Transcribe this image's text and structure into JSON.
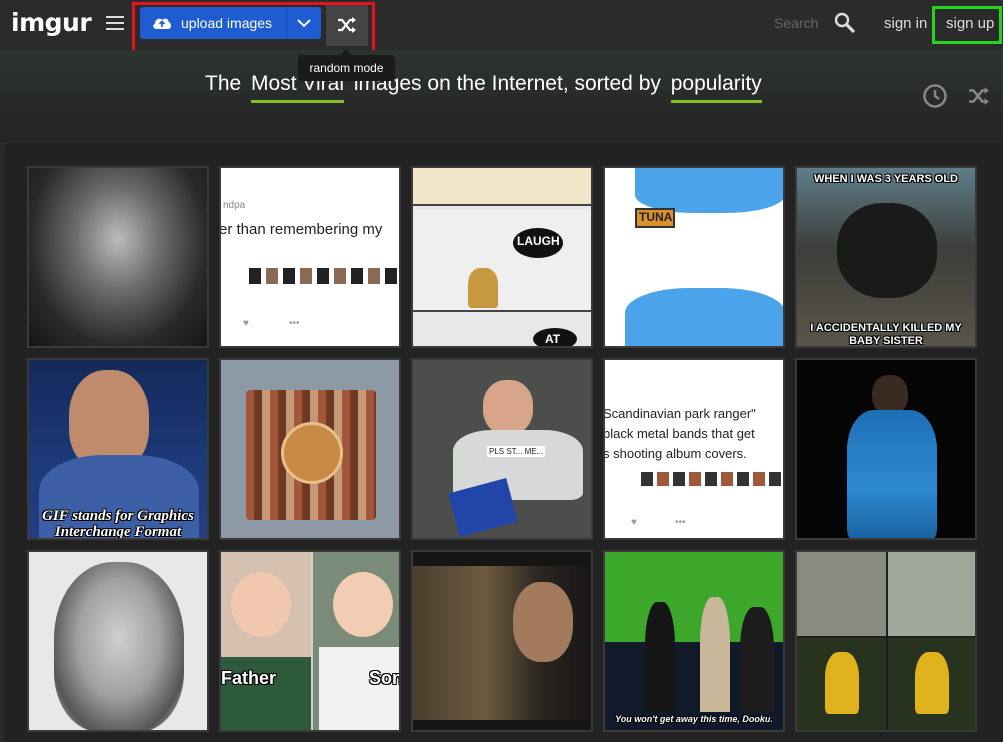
{
  "header": {
    "logo": "imgur",
    "upload_label": "upload images",
    "tooltip": "random mode",
    "search_placeholder": "Search",
    "signin": "sign in",
    "signup": "sign up"
  },
  "banner": {
    "prefix": "The",
    "section": "Most Viral",
    "middle": "images on the Internet, sorted by",
    "sort": "popularity"
  },
  "icons": {
    "menu": "hamburger-icon",
    "upload": "cloud-upload-icon",
    "caret": "chevron-down-icon",
    "random": "shuffle-icon",
    "search": "search-icon",
    "clock": "clock-icon"
  },
  "colors": {
    "upload_button": "#1f5bd1",
    "accent_underline": "#85bf25",
    "highlight_red": "#e5141b",
    "highlight_green": "#26d31f"
  },
  "gallery": {
    "row1": {
      "post_text": "er than remembering my",
      "post_handle": "ndpa",
      "comic_word": "LAUGH",
      "comic_word2": "AT",
      "tuna": "TUNA",
      "bear_top": "WHEN I WAS 3 YEARS OLD",
      "bear_bottom_1": "I ACCIDENTALLY KILLED MY",
      "bear_bottom_2": "BABY SISTER"
    },
    "row2": {
      "gif_1": "GIF stands for Graphics",
      "gif_2": "Interchange Format",
      "note_1": "Scandinavian park ranger\"",
      "note_2": "black metal bands that get",
      "note_3": "s shooting album covers.",
      "sign": "PLS ST... ME..."
    },
    "row3": {
      "father": "Father",
      "son": "Son",
      "dooku": "You won't get away this time, Dooku."
    }
  }
}
